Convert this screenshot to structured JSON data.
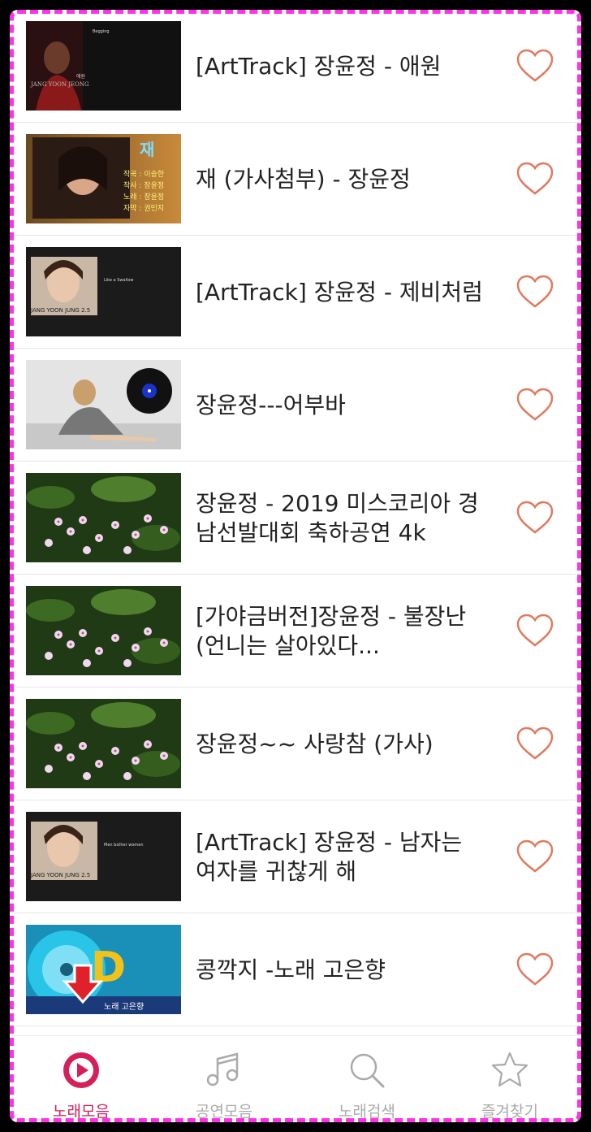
{
  "songs": [
    {
      "title": "[ArtTrack] 장윤정 - 애원",
      "thumb": "artwork-dark-portrait"
    },
    {
      "title": "재 (가사첨부) - 장윤정",
      "thumb": "album-cover-with-lyrics-credits"
    },
    {
      "title": "[ArtTrack] 장윤정 - 제비처럼",
      "thumb": "artwork-portrait-2.5"
    },
    {
      "title": "장윤정---어부바",
      "thumb": "woman-with-vinyl-record"
    },
    {
      "title": "장윤정 - 2019 미스코리아 경남선발대회 축하공연 4k",
      "thumb": "pink-flowers"
    },
    {
      "title": "[가야금버전]장윤정 - 불장난 (언니는 살아있다...",
      "thumb": "pink-flowers"
    },
    {
      "title": "장윤정~~ 사랑참 (가사)",
      "thumb": "pink-flowers"
    },
    {
      "title": "[ArtTrack] 장윤정 - 남자는 여자를 귀찮게 해",
      "thumb": "artwork-portrait-2.5"
    },
    {
      "title": "콩깍지 -노래 고은향",
      "thumb": "colorful-cd-with-download-arrow"
    }
  ],
  "thumb_text": {
    "t1_label": "애원",
    "t1_artist": "JANG YOON JEONG",
    "t1_song": "Begging",
    "t2_big": "재",
    "t2_lines": [
      "작곡 : 이승한",
      "작사 : 장윤정",
      "노래 : 장윤정",
      "자막 : 권민지"
    ],
    "t3_caption": "JANG YOON JUNG 2.5",
    "t3_song": "Like a Swallow",
    "t8_caption": "JANG YOON JUNG 2.5",
    "t8_song": "Men bother women",
    "t9_text": "노래 고은향"
  },
  "tabs": [
    {
      "label": "노래모음",
      "icon": "play-circle-icon",
      "active": true
    },
    {
      "label": "공연모음",
      "icon": "music-note-icon",
      "active": false
    },
    {
      "label": "노래검색",
      "icon": "search-icon",
      "active": false
    },
    {
      "label": "즐겨찾기",
      "icon": "star-icon",
      "active": false
    }
  ],
  "colors": {
    "accent": "#d41f5a",
    "heart": "#e07a5f",
    "dashed_border": "#ff33e6",
    "tab_inactive": "#aaaaaa"
  }
}
